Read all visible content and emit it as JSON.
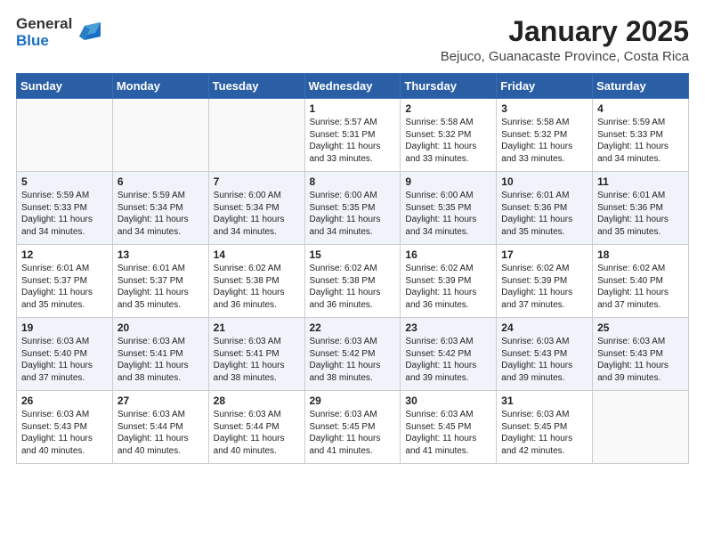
{
  "logo": {
    "general": "General",
    "blue": "Blue"
  },
  "title": "January 2025",
  "subtitle": "Bejuco, Guanacaste Province, Costa Rica",
  "days_of_week": [
    "Sunday",
    "Monday",
    "Tuesday",
    "Wednesday",
    "Thursday",
    "Friday",
    "Saturday"
  ],
  "weeks": [
    [
      {
        "day": "",
        "info": ""
      },
      {
        "day": "",
        "info": ""
      },
      {
        "day": "",
        "info": ""
      },
      {
        "day": "1",
        "info": "Sunrise: 5:57 AM\nSunset: 5:31 PM\nDaylight: 11 hours\nand 33 minutes."
      },
      {
        "day": "2",
        "info": "Sunrise: 5:58 AM\nSunset: 5:32 PM\nDaylight: 11 hours\nand 33 minutes."
      },
      {
        "day": "3",
        "info": "Sunrise: 5:58 AM\nSunset: 5:32 PM\nDaylight: 11 hours\nand 33 minutes."
      },
      {
        "day": "4",
        "info": "Sunrise: 5:59 AM\nSunset: 5:33 PM\nDaylight: 11 hours\nand 34 minutes."
      }
    ],
    [
      {
        "day": "5",
        "info": "Sunrise: 5:59 AM\nSunset: 5:33 PM\nDaylight: 11 hours\nand 34 minutes."
      },
      {
        "day": "6",
        "info": "Sunrise: 5:59 AM\nSunset: 5:34 PM\nDaylight: 11 hours\nand 34 minutes."
      },
      {
        "day": "7",
        "info": "Sunrise: 6:00 AM\nSunset: 5:34 PM\nDaylight: 11 hours\nand 34 minutes."
      },
      {
        "day": "8",
        "info": "Sunrise: 6:00 AM\nSunset: 5:35 PM\nDaylight: 11 hours\nand 34 minutes."
      },
      {
        "day": "9",
        "info": "Sunrise: 6:00 AM\nSunset: 5:35 PM\nDaylight: 11 hours\nand 34 minutes."
      },
      {
        "day": "10",
        "info": "Sunrise: 6:01 AM\nSunset: 5:36 PM\nDaylight: 11 hours\nand 35 minutes."
      },
      {
        "day": "11",
        "info": "Sunrise: 6:01 AM\nSunset: 5:36 PM\nDaylight: 11 hours\nand 35 minutes."
      }
    ],
    [
      {
        "day": "12",
        "info": "Sunrise: 6:01 AM\nSunset: 5:37 PM\nDaylight: 11 hours\nand 35 minutes."
      },
      {
        "day": "13",
        "info": "Sunrise: 6:01 AM\nSunset: 5:37 PM\nDaylight: 11 hours\nand 35 minutes."
      },
      {
        "day": "14",
        "info": "Sunrise: 6:02 AM\nSunset: 5:38 PM\nDaylight: 11 hours\nand 36 minutes."
      },
      {
        "day": "15",
        "info": "Sunrise: 6:02 AM\nSunset: 5:38 PM\nDaylight: 11 hours\nand 36 minutes."
      },
      {
        "day": "16",
        "info": "Sunrise: 6:02 AM\nSunset: 5:39 PM\nDaylight: 11 hours\nand 36 minutes."
      },
      {
        "day": "17",
        "info": "Sunrise: 6:02 AM\nSunset: 5:39 PM\nDaylight: 11 hours\nand 37 minutes."
      },
      {
        "day": "18",
        "info": "Sunrise: 6:02 AM\nSunset: 5:40 PM\nDaylight: 11 hours\nand 37 minutes."
      }
    ],
    [
      {
        "day": "19",
        "info": "Sunrise: 6:03 AM\nSunset: 5:40 PM\nDaylight: 11 hours\nand 37 minutes."
      },
      {
        "day": "20",
        "info": "Sunrise: 6:03 AM\nSunset: 5:41 PM\nDaylight: 11 hours\nand 38 minutes."
      },
      {
        "day": "21",
        "info": "Sunrise: 6:03 AM\nSunset: 5:41 PM\nDaylight: 11 hours\nand 38 minutes."
      },
      {
        "day": "22",
        "info": "Sunrise: 6:03 AM\nSunset: 5:42 PM\nDaylight: 11 hours\nand 38 minutes."
      },
      {
        "day": "23",
        "info": "Sunrise: 6:03 AM\nSunset: 5:42 PM\nDaylight: 11 hours\nand 39 minutes."
      },
      {
        "day": "24",
        "info": "Sunrise: 6:03 AM\nSunset: 5:43 PM\nDaylight: 11 hours\nand 39 minutes."
      },
      {
        "day": "25",
        "info": "Sunrise: 6:03 AM\nSunset: 5:43 PM\nDaylight: 11 hours\nand 39 minutes."
      }
    ],
    [
      {
        "day": "26",
        "info": "Sunrise: 6:03 AM\nSunset: 5:43 PM\nDaylight: 11 hours\nand 40 minutes."
      },
      {
        "day": "27",
        "info": "Sunrise: 6:03 AM\nSunset: 5:44 PM\nDaylight: 11 hours\nand 40 minutes."
      },
      {
        "day": "28",
        "info": "Sunrise: 6:03 AM\nSunset: 5:44 PM\nDaylight: 11 hours\nand 40 minutes."
      },
      {
        "day": "29",
        "info": "Sunrise: 6:03 AM\nSunset: 5:45 PM\nDaylight: 11 hours\nand 41 minutes."
      },
      {
        "day": "30",
        "info": "Sunrise: 6:03 AM\nSunset: 5:45 PM\nDaylight: 11 hours\nand 41 minutes."
      },
      {
        "day": "31",
        "info": "Sunrise: 6:03 AM\nSunset: 5:45 PM\nDaylight: 11 hours\nand 42 minutes."
      },
      {
        "day": "",
        "info": ""
      }
    ]
  ]
}
